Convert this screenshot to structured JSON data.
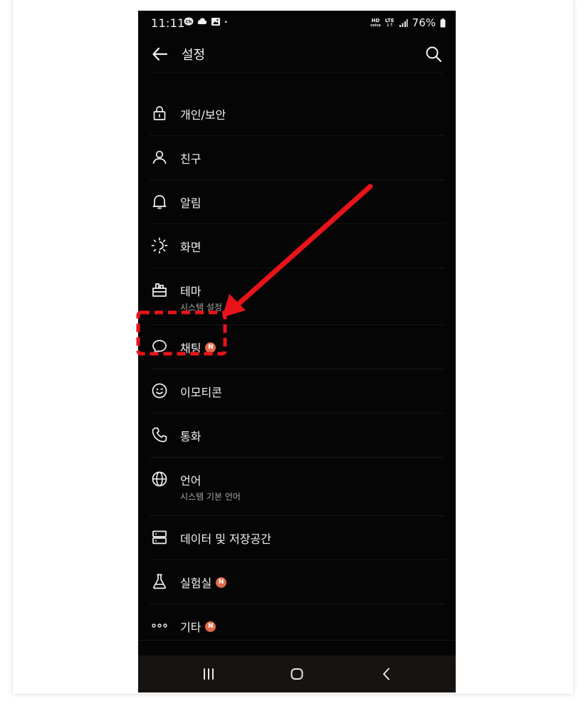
{
  "status_bar": {
    "time": "11:11",
    "notification_icons": [
      "chat-bubble-ch-icon",
      "cloud-icon",
      "image-icon",
      "dot-icon"
    ],
    "network_hd": "HD",
    "network_voice": "voice",
    "network_lte": "LTE",
    "battery": "76%"
  },
  "header": {
    "title": "설정"
  },
  "menu": {
    "items": [
      {
        "label": "개인/보안",
        "icon": "lock-icon"
      },
      {
        "label": "친구",
        "icon": "person-icon"
      },
      {
        "label": "알림",
        "icon": "bell-icon"
      },
      {
        "label": "화면",
        "icon": "sun-icon"
      },
      {
        "label": "테마",
        "icon": "theme-icon",
        "sub": "시스템 설정 모드"
      },
      {
        "label": "채팅",
        "icon": "chat-icon",
        "badge": "N"
      },
      {
        "label": "이모티콘",
        "icon": "emoticon-icon"
      },
      {
        "label": "통화",
        "icon": "phone-icon"
      },
      {
        "label": "언어",
        "icon": "globe-icon",
        "sub": "시스템 기본 언어"
      },
      {
        "label": "데이터 및 저장공간",
        "icon": "storage-icon"
      },
      {
        "label": "실험실",
        "icon": "flask-icon",
        "badge": "N"
      },
      {
        "label": "기타",
        "icon": "more-dots-icon",
        "badge": "N"
      }
    ]
  },
  "annotation": {
    "arrow_color": "#e8141a",
    "highlight_target": "채팅"
  },
  "colors": {
    "background": "#050505",
    "text": "#f2f2f2",
    "subtext": "#a8a8a8",
    "badge": "#e06a4a",
    "annotation": "#e8141a"
  }
}
